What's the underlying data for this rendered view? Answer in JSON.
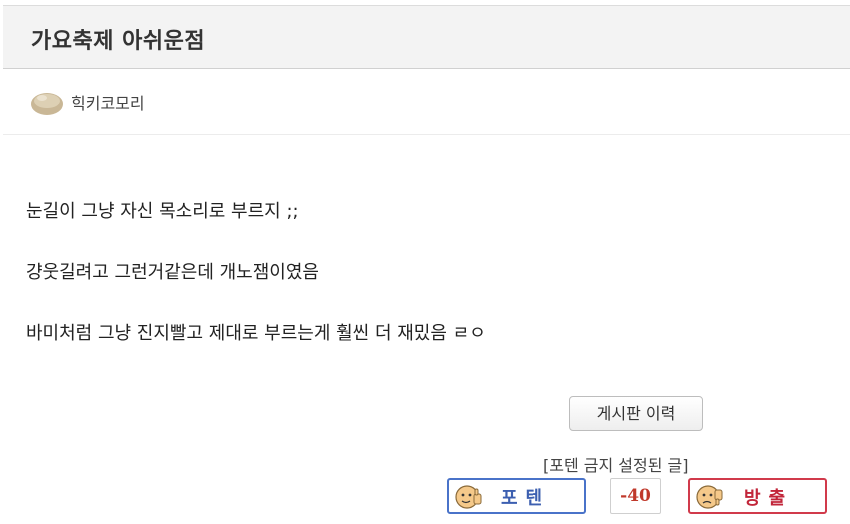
{
  "post": {
    "title": "가요축제 아쉬운점",
    "author": "힉키코모리",
    "content_lines": [
      "눈길이 그냥 자신 목소리로 부르지 ;;",
      "걍웃길려고 그런거같은데 개노잼이였음",
      "바미처럼 그냥 진지빨고 제대로 부르는게 훨씬 더 재밌음 ㄹㅇ"
    ]
  },
  "actions": {
    "history_label": "게시판 이력",
    "notice": "[포텐 금지 설정된 글]",
    "vote_up_label": "포텐",
    "vote_down_label": "방출",
    "vote_count": "-40"
  },
  "colors": {
    "vote_up_border": "#4a73c9",
    "vote_down_border": "#d13a4b",
    "vote_count_color": "#c0392b"
  }
}
